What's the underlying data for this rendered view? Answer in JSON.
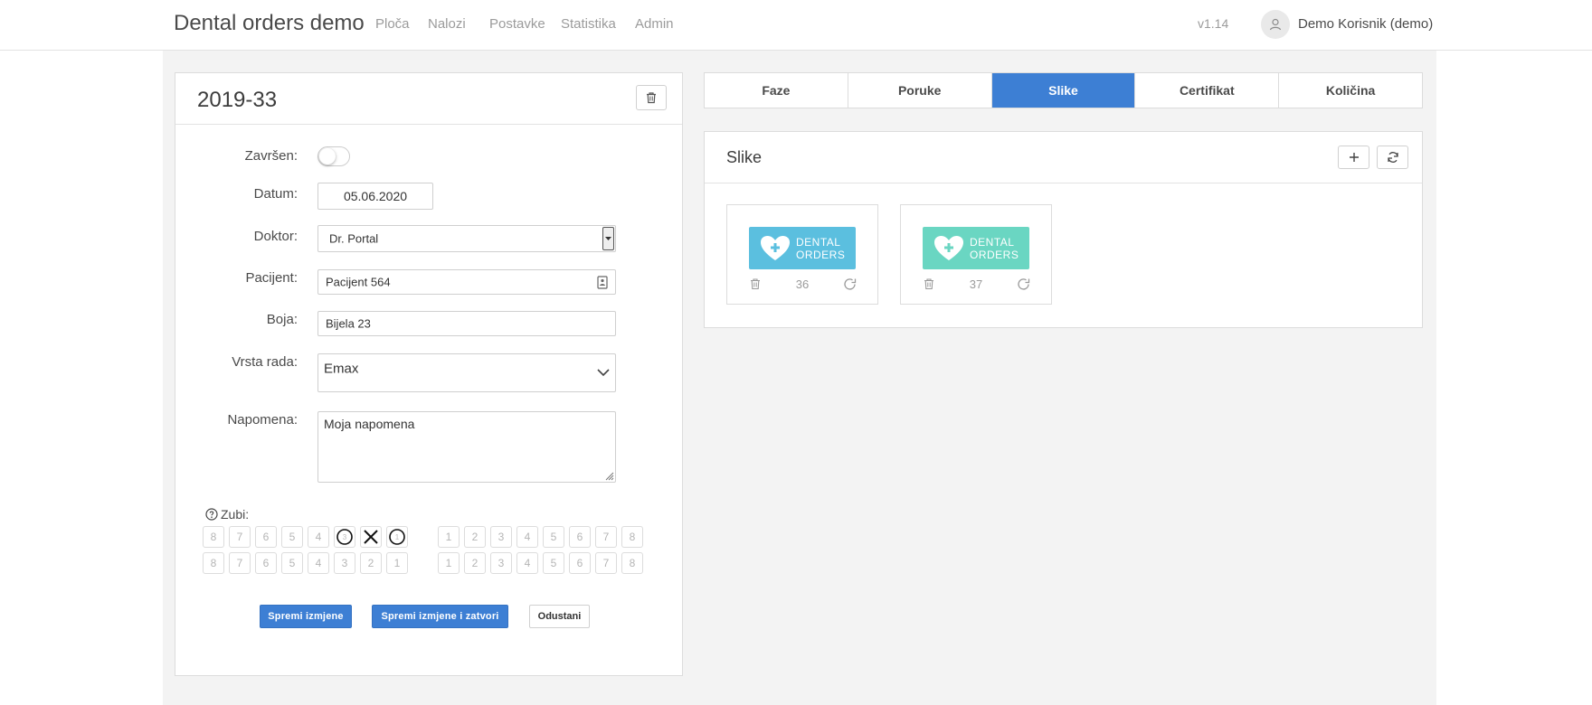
{
  "app": {
    "title": "Dental orders demo",
    "version": "v1.14",
    "user": "Demo Korisnik (demo)"
  },
  "nav": {
    "items": [
      "Ploča",
      "Nalozi",
      "Postavke",
      "Statistika",
      "Admin"
    ]
  },
  "order": {
    "title": "2019-33",
    "labels": {
      "zavrsen": "Završen:",
      "datum": "Datum:",
      "doktor": "Doktor:",
      "pacijent": "Pacijent:",
      "boja": "Boja:",
      "vrsta_rada": "Vrsta rada:",
      "napomena": "Napomena:",
      "zubi": "Zubi:"
    },
    "values": {
      "zavrsen": false,
      "datum": "05.06.2020",
      "doktor": "Dr. Portal",
      "pacijent": "Pacijent 564",
      "boja": "Bijela 23",
      "vrsta_rada": "Emax",
      "napomena": "Moja napomena"
    },
    "teeth": {
      "upper_left": [
        "8",
        "7",
        "6",
        "5",
        "4",
        "3",
        "2",
        "1"
      ],
      "upper_right": [
        "1",
        "2",
        "3",
        "4",
        "5",
        "6",
        "7",
        "8"
      ],
      "lower_left": [
        "8",
        "7",
        "6",
        "5",
        "4",
        "3",
        "2",
        "1"
      ],
      "lower_right": [
        "1",
        "2",
        "3",
        "4",
        "5",
        "6",
        "7",
        "8"
      ],
      "marked_upper_left": {
        "3": "circle",
        "2": "cross",
        "1": "circle"
      }
    },
    "buttons": {
      "save": "Spremi izmjene",
      "save_close": "Spremi izmjene i zatvori",
      "cancel": "Odustani"
    }
  },
  "tabs": [
    {
      "label": "Faze",
      "active": false
    },
    {
      "label": "Poruke",
      "active": false
    },
    {
      "label": "Slike",
      "active": true
    },
    {
      "label": "Certifikat",
      "active": false
    },
    {
      "label": "Količina",
      "active": false
    }
  ],
  "images": {
    "title": "Slike",
    "items": [
      {
        "id": "36",
        "logo_line1": "DENTAL",
        "logo_line2": "ORDERS",
        "color": "#5bbfdf"
      },
      {
        "id": "37",
        "logo_line1": "DENTAL",
        "logo_line2": "ORDERS",
        "color": "#6ad6c2"
      }
    ]
  },
  "colors": {
    "accent": "#3d7fd4",
    "background": "#f3f3f3"
  }
}
